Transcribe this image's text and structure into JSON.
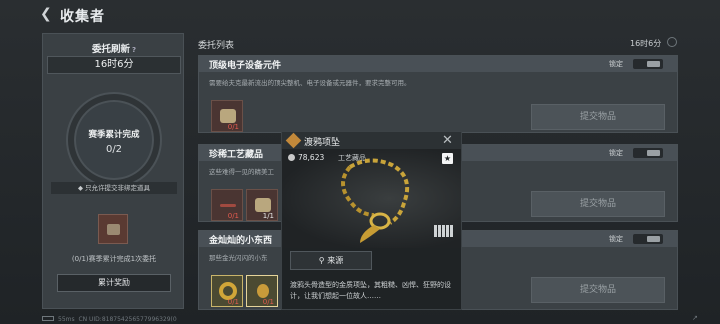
{
  "header": {
    "back_icon": "chevron-left-icon",
    "title": "收集者"
  },
  "left_panel": {
    "title": "委托刷新",
    "help_icon": "question-icon",
    "timer": "16时6分",
    "progress_label": "赛季累计完成",
    "progress_value": "0/2",
    "note": "只允许提交非绑定道具",
    "item_icon": "chest-icon",
    "desc": "(0/1)赛季累计完成1次委托",
    "reward_button": "累计奖励"
  },
  "list": {
    "title": "委托列表",
    "timer": "16时6分",
    "refresh_icon": "refresh-icon",
    "cards": [
      {
        "name": "顶级电子设备元件",
        "lock_label": "锁定",
        "desc": "需要给夫克最新流出的顶尖整机、电子设备或元器件，要求完整可用。",
        "slots": [
          {
            "count": "0/1",
            "icon": "electronics-icon"
          }
        ],
        "submit": "提交物品"
      },
      {
        "name": "珍稀工艺藏品",
        "lock_label": "锁定",
        "desc": "这些难得一见的精美工",
        "slots": [
          {
            "count": "0/1",
            "icon": "sword-icon"
          },
          {
            "count": "1/1",
            "icon": "lantern-icon"
          }
        ],
        "submit": "提交物品"
      },
      {
        "name": "金灿灿的小东西",
        "lock_label": "锁定",
        "desc": "那些金光闪闪的小东",
        "slots": [
          {
            "count": "0/1",
            "icon": "gold-ring-icon"
          },
          {
            "count": "0/1",
            "icon": "gold-pendant-icon"
          }
        ],
        "submit": "提交物品"
      }
    ]
  },
  "popup": {
    "icon": "diamond-icon",
    "name": "渡鸦项坠",
    "close_icon": "close-icon",
    "value": "78,623",
    "coin_icon": "coin-icon",
    "category": "工艺藏品",
    "star_icon": "star-icon",
    "size_icon": "grid-size-icon",
    "source_button": "来源",
    "search_icon": "search-icon",
    "description": "渡鸦头骨造型的金质项坠，其粗糙、凶悍、狂野的设计，让我们想起一位故人……"
  },
  "footer": {
    "battery_icon": "battery-icon",
    "ping": "55ms",
    "uid": "CN UID:818754256577996329(0"
  }
}
